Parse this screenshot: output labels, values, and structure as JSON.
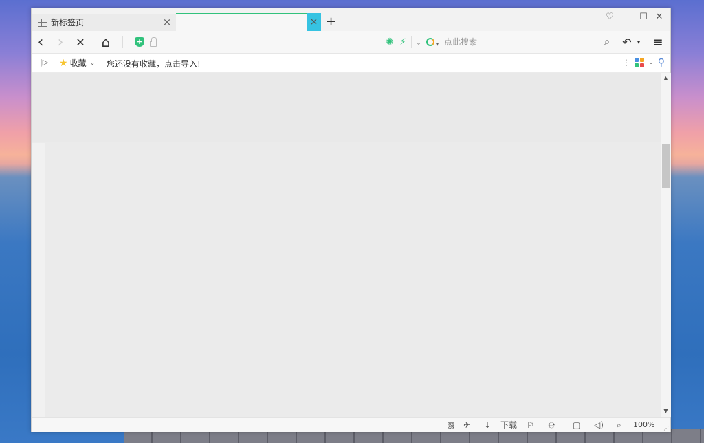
{
  "tabs": [
    {
      "title": "新标签页"
    },
    {
      "title": ""
    }
  ],
  "tab_close_glyph": "×",
  "new_tab_glyph": "+",
  "window_controls": {
    "skin": "♡",
    "minimize": "—",
    "maximize": "☐",
    "close": "✕"
  },
  "nav": {
    "back": "‹",
    "forward": "›",
    "stop": "✕",
    "home": "⌂",
    "shield_glyph": "+",
    "accel_glyph": "⚡",
    "dropdown_glyph": "⌄",
    "undo_glyph": "↶",
    "menu_glyph": "≡",
    "search_glyph": "⌕"
  },
  "search": {
    "placeholder": "点此搜索"
  },
  "bookmarks": {
    "toggle": "|▷",
    "favorites_label": "收藏",
    "hint": "您还没有收藏，点击导入!"
  },
  "status": {
    "download_label": "下载",
    "zoom": "100%"
  },
  "colors": {
    "accent": "#31c27c",
    "active_tab_close_bg": "#36c3e2",
    "star": "#f7c42f"
  }
}
